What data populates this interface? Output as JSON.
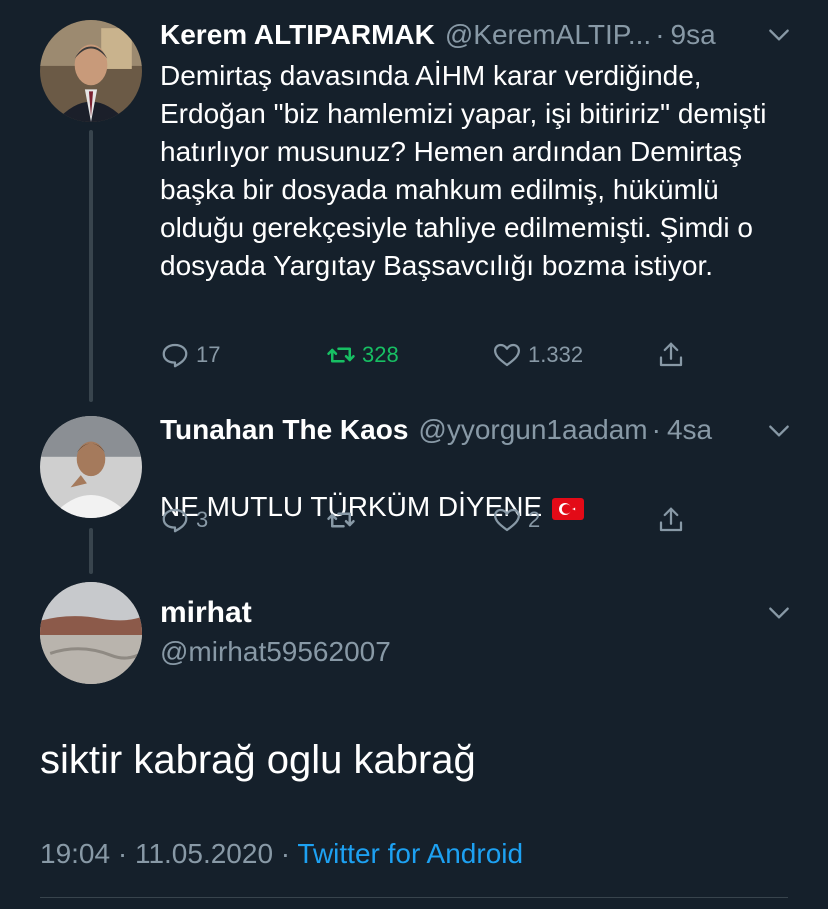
{
  "tweets": [
    {
      "author_name": "Kerem ALTIPARMAK",
      "author_handle": "@KeremALTIP...",
      "separator": "·",
      "time": "9sa",
      "text": "Demirtaş davasında AİHM karar verdiğinde, Erdoğan \"biz hamlemizi yapar, işi bitiririz\" demişti hatırlıyor musunuz? Hemen ardından Demirtaş başka bir dosyada mahkum edilmiş, hükümlü olduğu gerekçesiyle tahliye edilmemişti. Şimdi o dosyada Yargıtay Başsavcılığı bozma istiyor.",
      "reply_count": "17",
      "retweet_count": "328",
      "like_count": "1.332"
    },
    {
      "author_name": "Tunahan The Kaos",
      "author_handle": "@yyorgun1aadam",
      "separator": "·",
      "time": "4sa",
      "text": "NE MUTLU TÜRKÜM DİYENE",
      "reply_count": "3",
      "retweet_count": "",
      "like_count": "2"
    }
  ],
  "main_tweet": {
    "author_name": "mirhat",
    "author_handle": "@mirhat59562007",
    "text": "siktir kabrağ oglu kabrağ",
    "timestamp": "19:04 · 11.05.2020 ·",
    "source": "Twitter for Android"
  },
  "colors": {
    "background": "#15202b",
    "secondary_text": "#8899a6",
    "retweet_active": "#17bf63",
    "link": "#1da1f2"
  },
  "icons": [
    "reply-icon",
    "retweet-icon",
    "like-icon",
    "share-icon",
    "chevron-down-icon",
    "turkish-flag-emoji"
  ]
}
